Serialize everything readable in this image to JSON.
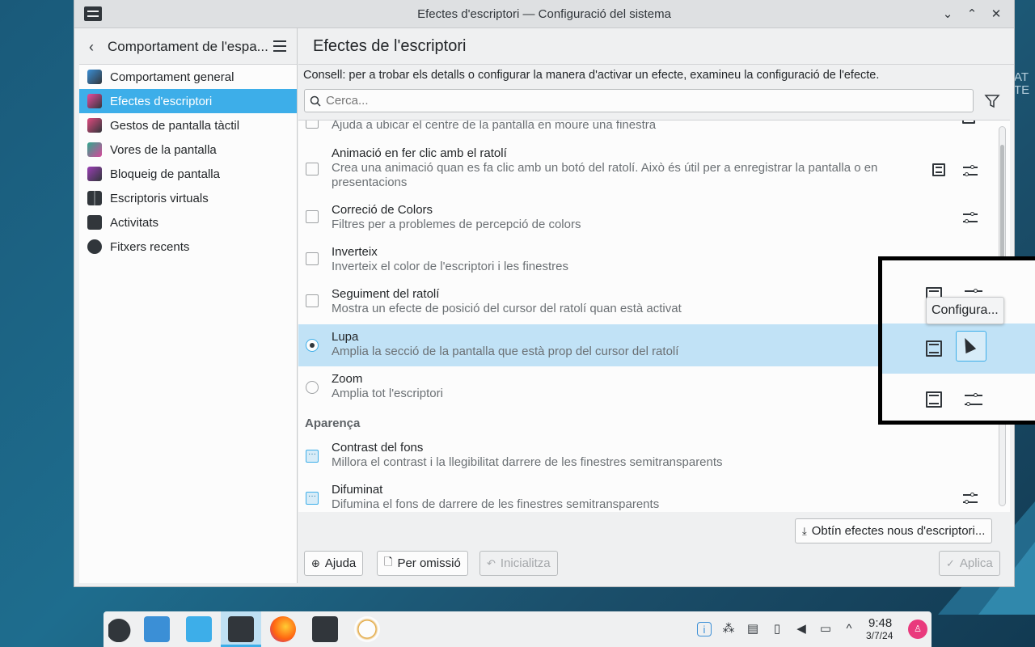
{
  "desktop": {
    "corner_text": "AT\nTE"
  },
  "window": {
    "title": "Efectes d'escriptori — Configuració del sistema",
    "minimize_glyph": "⌄",
    "maximize_glyph": "⌃",
    "close_glyph": "✕"
  },
  "sidebar": {
    "back_glyph": "‹",
    "title": "Comportament de l'espa...",
    "items": [
      {
        "label": "Comportament general",
        "icon": "general-behavior-icon",
        "color": "#3b8fd6"
      },
      {
        "label": "Efectes d'escriptori",
        "icon": "desktop-effects-icon",
        "color": "#e94c9c",
        "active": true
      },
      {
        "label": "Gestos de pantalla tàctil",
        "icon": "touch-gestures-icon",
        "color": "#e04a7f"
      },
      {
        "label": "Vores de la pantalla",
        "icon": "screen-edges-icon",
        "color": "#d7479a"
      },
      {
        "label": "Bloqueig de pantalla",
        "icon": "screen-lock-icon",
        "color": "#9b3fb5"
      },
      {
        "label": "Escriptoris virtuals",
        "icon": "virtual-desktops-icon",
        "color": "#31363b"
      },
      {
        "label": "Activitats",
        "icon": "activities-icon",
        "color": "#31363b"
      },
      {
        "label": "Fitxers recents",
        "icon": "recent-files-icon",
        "color": "#31363b"
      }
    ]
  },
  "main": {
    "title": "Efectes de l'escriptori",
    "hint": "Consell: per a trobar els detalls o configurar la manera d'activar un efecte, examineu la configuració de l'efecte.",
    "search_placeholder": "Cerca...",
    "effects": [
      {
        "name": "",
        "desc": "Ajuda a ubicar el centre de la pantalla en moure una finestra",
        "control": "checkbox"
      },
      {
        "name": "Animació en fer clic amb el ratolí",
        "desc": "Crea una animació quan es fa clic amb un botó del ratolí. Això és útil per a enregistrar la pantalla o en presentacions",
        "control": "checkbox"
      },
      {
        "name": "Correció de Colors",
        "desc": "Filtres per a problemes de percepció de colors",
        "control": "checkbox"
      },
      {
        "name": "Inverteix",
        "desc": "Inverteix el color de l'escriptori i les finestres",
        "control": "checkbox"
      },
      {
        "name": "Seguiment del ratolí",
        "desc": "Mostra un efecte de posició del cursor del ratolí quan està activat",
        "control": "checkbox"
      },
      {
        "name": "Lupa",
        "desc": "Amplia la secció de la pantalla que està prop del cursor del ratolí",
        "control": "radio",
        "checked": true,
        "selected": true
      },
      {
        "name": "Zoom",
        "desc": "Amplia tot l'escriptori",
        "control": "radio"
      }
    ],
    "section_appearance": "Aparença",
    "appearance_effects": [
      {
        "name": "Contrast del fons",
        "desc": "Millora el contrast i la llegibilitat darrere de les finestres semitransparents",
        "control": "exclusive"
      },
      {
        "name": "Difuminat",
        "desc": "Difumina el fons de darrere de les finestres semitransparents",
        "control": "exclusive"
      }
    ],
    "get_new_label": "Obtín efectes nous d'escriptori...",
    "help_label": "Ajuda",
    "defaults_label": "Per omissió",
    "reset_label": "Inicialitza",
    "apply_label": "Aplica"
  },
  "tooltip": "Configura...",
  "taskbar": {
    "apps": [
      "kde-launcher-icon",
      "discover-icon",
      "dolphin-icon",
      "system-settings-icon",
      "firefox-icon",
      "kcalc-icon",
      "kolourpaint-icon"
    ],
    "tray": [
      "accessibility-icon",
      "kdeconnect-icon",
      "clipboard-icon",
      "usb-icon",
      "volume-icon",
      "network-icon",
      "tray-expand-icon"
    ],
    "time": "9:48",
    "date": "3/7/24",
    "avatar_glyph": "♙"
  }
}
